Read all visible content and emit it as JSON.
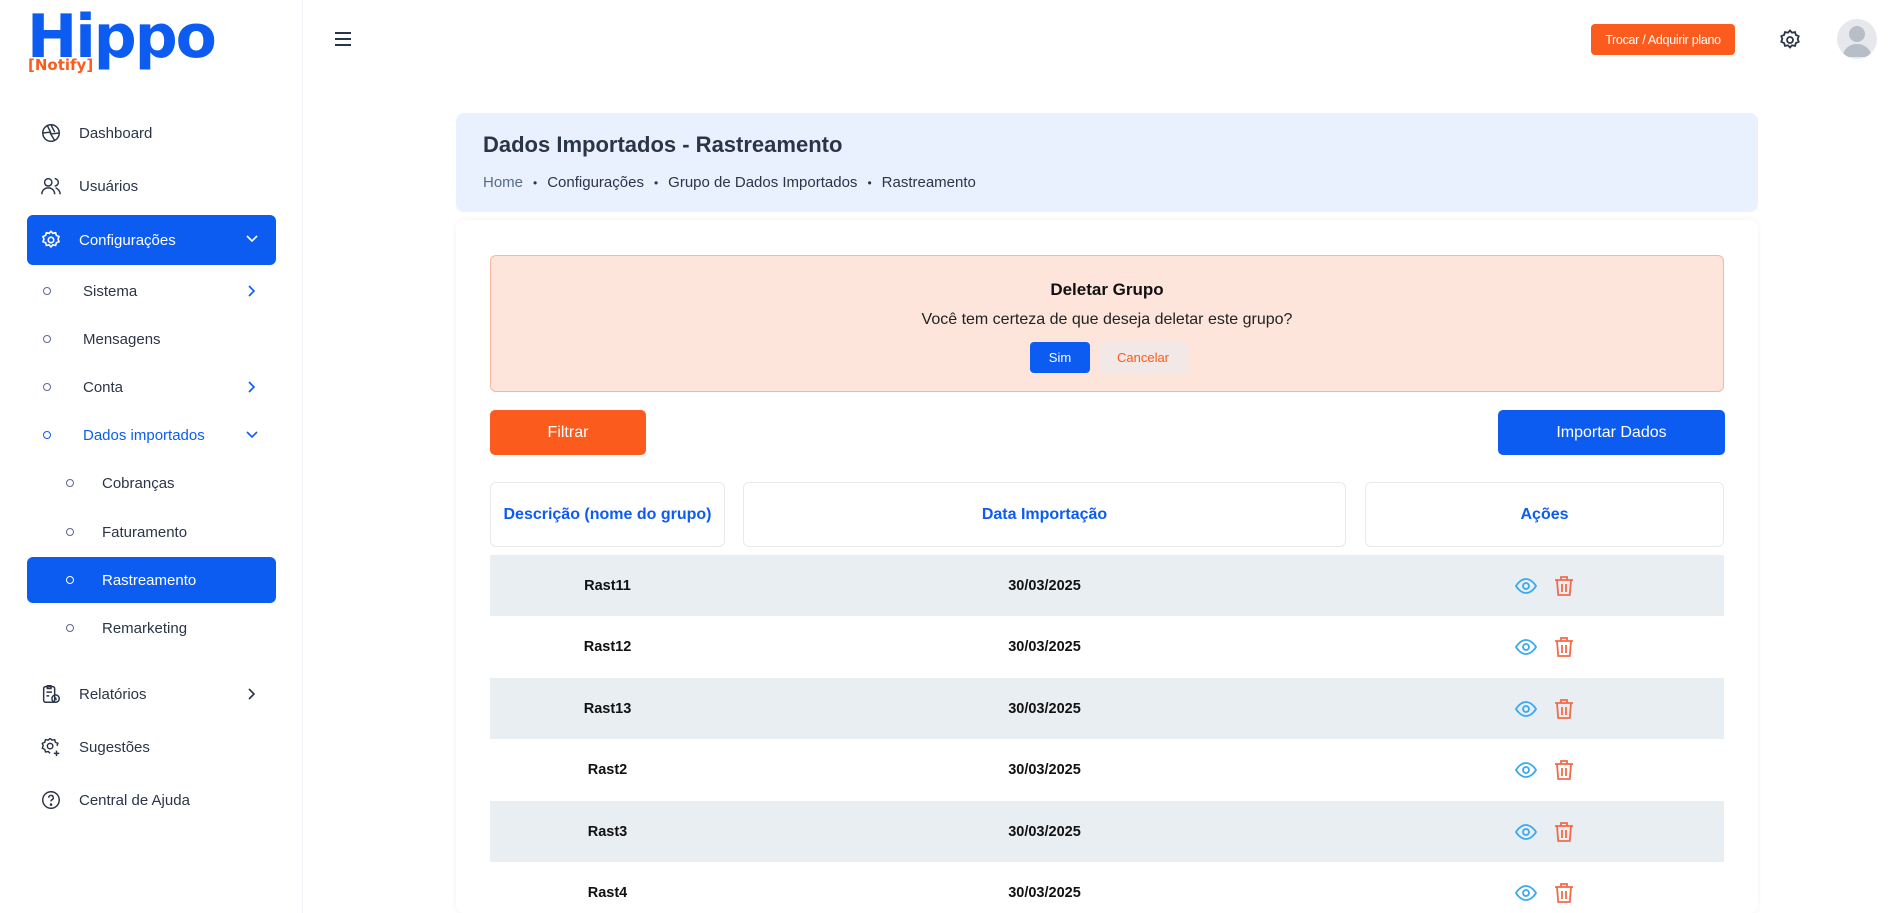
{
  "brand": {
    "name": "Hippo",
    "tagline": "[Notify]",
    "primary_color": "#0d5cf2",
    "accent_color": "#fb5b1c"
  },
  "topbar": {
    "plan_button": "Trocar / Adquirir plano"
  },
  "sidebar": {
    "dashboard": "Dashboard",
    "usuarios": "Usuários",
    "configuracoes": "Configurações",
    "sistema": "Sistema",
    "mensagens": "Mensagens",
    "conta": "Conta",
    "dados_importados": "Dados importados",
    "cobrancas": "Cobranças",
    "faturamento": "Faturamento",
    "rastreamento": "Rastreamento",
    "remarketing": "Remarketing",
    "relatorios": "Relatórios",
    "sugestoes": "Sugestões",
    "central_ajuda": "Central de Ajuda"
  },
  "header": {
    "title": "Dados Importados - Rastreamento",
    "breadcrumb": [
      "Home",
      "Configurações",
      "Grupo de Dados Importados",
      "Rastreamento"
    ]
  },
  "alert": {
    "title": "Deletar Grupo",
    "message": "Você tem certeza de que deseja deletar este grupo?",
    "confirm": "Sim",
    "cancel": "Cancelar"
  },
  "actions": {
    "filter": "Filtrar",
    "import": "Importar Dados"
  },
  "table": {
    "columns": [
      "Descrição (nome do grupo)",
      "Data Importação",
      "Ações"
    ],
    "rows": [
      {
        "name": "Rast11",
        "date": "30/03/2025"
      },
      {
        "name": "Rast12",
        "date": "30/03/2025"
      },
      {
        "name": "Rast13",
        "date": "30/03/2025"
      },
      {
        "name": "Rast2",
        "date": "30/03/2025"
      },
      {
        "name": "Rast3",
        "date": "30/03/2025"
      },
      {
        "name": "Rast4",
        "date": "30/03/2025"
      }
    ],
    "row_icons": [
      "eye-icon",
      "trash-icon"
    ]
  }
}
